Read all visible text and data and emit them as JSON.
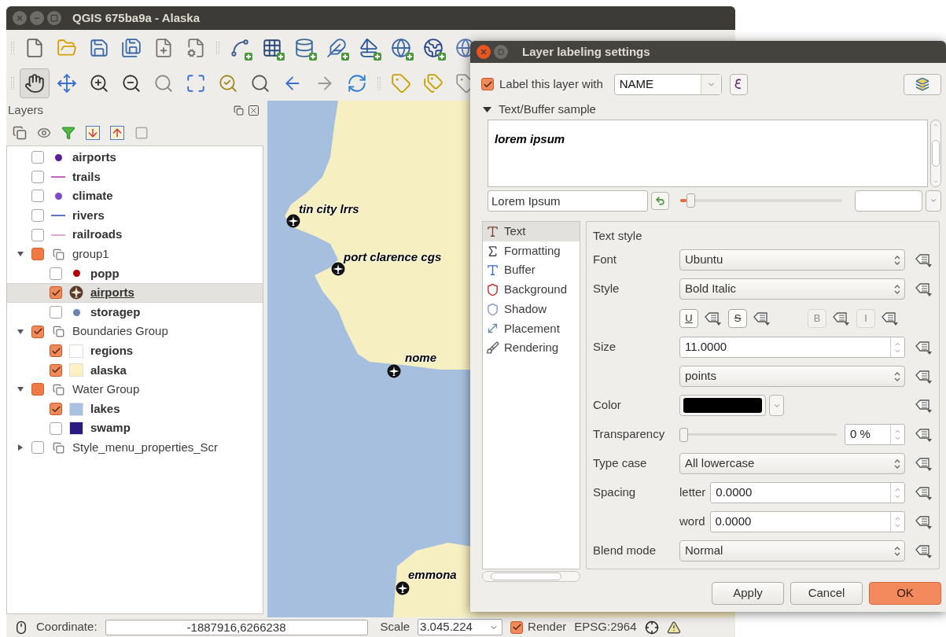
{
  "window": {
    "title": "QGIS 675ba9a - Alaska"
  },
  "navigation_tools": [
    {
      "selected": true
    },
    {
      "selected": false
    },
    {
      "selected": false
    },
    {
      "selected": false
    },
    {
      "selected": false
    },
    {
      "selected": false
    },
    {
      "selected": false
    },
    {
      "selected": false
    },
    {
      "selected": false
    },
    {
      "selected": false
    },
    {
      "selected": false
    }
  ],
  "layers_panel": {
    "title": "Layers",
    "items": [
      {
        "name": "airports",
        "kind": "point",
        "color": "#5b1f96",
        "checked": false,
        "selected": false
      },
      {
        "name": "trails",
        "kind": "line",
        "color": "#c266c2",
        "checked": false,
        "selected": false
      },
      {
        "name": "climate",
        "kind": "point",
        "color": "#7a4dc4",
        "checked": false,
        "selected": false
      },
      {
        "name": "rivers",
        "kind": "line",
        "color": "#5f74cf",
        "checked": false,
        "selected": false
      },
      {
        "name": "railroads",
        "kind": "line",
        "color": "#e2a6d6",
        "checked": false,
        "selected": false
      },
      {
        "name": "group1",
        "kind": "group",
        "checked": false,
        "selected": false,
        "expanded": true,
        "children": [
          {
            "name": "popp",
            "kind": "point",
            "color": "#b50000",
            "checked": false,
            "selected": false
          },
          {
            "name": "airports",
            "kind": "airport",
            "color": "#5a3a2a",
            "checked": true,
            "selected": true
          },
          {
            "name": "storagep",
            "kind": "point",
            "color": "#6a82b4",
            "checked": false,
            "selected": false
          }
        ]
      },
      {
        "name": "Boundaries Group",
        "kind": "group",
        "checked": true,
        "selected": false,
        "expanded": true,
        "children": [
          {
            "name": "regions",
            "kind": "polygon",
            "color": "#ffffff",
            "checked": true,
            "selected": false
          },
          {
            "name": "alaska",
            "kind": "polygon",
            "color": "#fbf1c2",
            "checked": true,
            "selected": false
          }
        ]
      },
      {
        "name": "Water Group",
        "kind": "group",
        "checked": false,
        "selected": false,
        "expanded": true,
        "children": [
          {
            "name": "lakes",
            "kind": "polygon",
            "color": "#a9c1e1",
            "checked": true,
            "selected": false
          },
          {
            "name": "swamp",
            "kind": "polygon",
            "color": "#2a1a82",
            "checked": false,
            "selected": false
          }
        ]
      },
      {
        "name": "Style_menu_properties_Scr",
        "kind": "group",
        "checked": false,
        "selected": false,
        "expanded": false
      }
    ]
  },
  "map": {
    "labels": [
      {
        "text": "tin city lrrs"
      },
      {
        "text": "port clarence cgs"
      },
      {
        "text": "nome"
      },
      {
        "text": "emmona"
      }
    ]
  },
  "status_bar": {
    "coordinate_label": "Coordinate:",
    "coordinate": "-1887916,6266238",
    "scale_label": "Scale",
    "scale": "3.045.224",
    "render": {
      "label": "Render",
      "checked": true
    },
    "crs": "EPSG:2964"
  },
  "dialog": {
    "title": "Layer labeling settings",
    "label_enabled": {
      "label": "Label this layer with",
      "checked": true
    },
    "field": {
      "value": "NAME"
    },
    "sample_section": {
      "title": "Text/Buffer sample",
      "expanded": true
    },
    "sample_text": "lorem ipsum",
    "sample_input": {
      "value": "Lorem Ipsum"
    },
    "sample_zoom": {
      "level": 0.04
    },
    "tabs": [
      {
        "label": "Text",
        "selected": true
      },
      {
        "label": "Formatting",
        "selected": false
      },
      {
        "label": "Buffer",
        "selected": false
      },
      {
        "label": "Background",
        "selected": false
      },
      {
        "label": "Shadow",
        "selected": false
      },
      {
        "label": "Placement",
        "selected": false
      },
      {
        "label": "Rendering",
        "selected": false
      }
    ],
    "text_style": {
      "title": "Text style",
      "rows": [
        {
          "kind": "combo",
          "label": "Font",
          "value": "Ubuntu"
        },
        {
          "kind": "combo",
          "label": "Style",
          "value": "Bold Italic"
        },
        {
          "kind": "toggles",
          "items": [
            {
              "label": "U",
              "disabled": false
            },
            {
              "label": "S",
              "disabled": false
            },
            {
              "label": "B",
              "disabled": true
            },
            {
              "label": "I",
              "disabled": true
            }
          ]
        },
        {
          "kind": "spin",
          "label": "Size",
          "value": "11.0000"
        },
        {
          "kind": "combo",
          "value": "points"
        },
        {
          "kind": "color",
          "label": "Color",
          "color": "#000000"
        },
        {
          "kind": "slider",
          "label": "Transparency",
          "level": 0,
          "value": "0 %"
        },
        {
          "kind": "combo",
          "label": "Type case",
          "value": "All lowercase"
        },
        {
          "kind": "spin",
          "label": "Spacing",
          "sublabel": "letter",
          "value": "0.0000"
        },
        {
          "kind": "spin",
          "sublabel": "word",
          "value": "0.0000"
        },
        {
          "kind": "combo",
          "label": "Blend mode",
          "value": "Normal"
        }
      ]
    },
    "buttons": [
      {
        "label": "Apply",
        "primary": false
      },
      {
        "label": "Cancel",
        "primary": false
      },
      {
        "label": "OK",
        "primary": true
      }
    ]
  }
}
